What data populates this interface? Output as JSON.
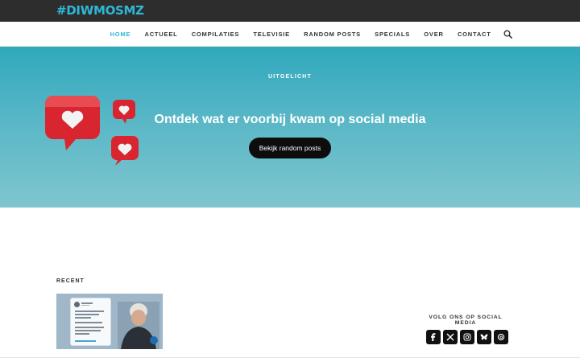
{
  "brand": {
    "logo_text": "#DIWMOSMZ",
    "accent": "#2fb7d6"
  },
  "nav": {
    "items": [
      {
        "label": "HOME",
        "active": true
      },
      {
        "label": "ACTUEEL"
      },
      {
        "label": "COMPILATIES"
      },
      {
        "label": "TELEVISIE"
      },
      {
        "label": "RANDOM POSTS"
      },
      {
        "label": "SPECIALS"
      },
      {
        "label": "OVER"
      },
      {
        "label": "CONTACT"
      }
    ],
    "search_icon": "search-icon"
  },
  "hero": {
    "eyebrow": "UITGELICHT",
    "title": "Ontdek wat er voorbij kwam op social media",
    "button_label": "Bekijk random posts",
    "gradient": [
      "#2fa9bd",
      "#7fc6cf"
    ]
  },
  "recent": {
    "heading": "RECENT"
  },
  "social": {
    "heading": "VOLG ONS OP SOCIAL MEDIA",
    "icons": [
      "facebook-icon",
      "x-icon",
      "instagram-icon",
      "bluesky-icon",
      "threads-icon"
    ]
  }
}
